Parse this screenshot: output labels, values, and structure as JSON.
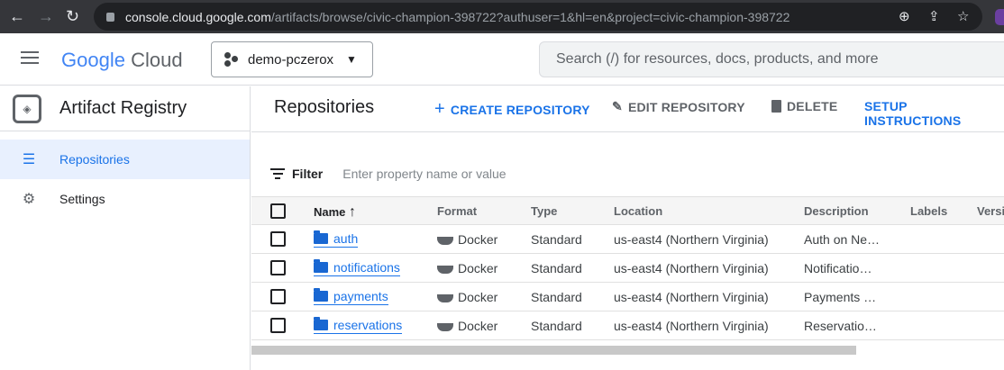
{
  "browser": {
    "url_host": "console.cloud.google.com",
    "url_path": "/artifacts/browse/civic-champion-398722?authuser=1&hl=en&project=civic-champion-398722"
  },
  "header": {
    "logo_google": "Google",
    "logo_cloud": "Cloud",
    "project": "demo-pczerox",
    "search_placeholder": "Search (/) for resources, docs, products, and more"
  },
  "sidebar": {
    "product": "Artifact Registry",
    "items": [
      {
        "label": "Repositories",
        "icon": "list-icon",
        "active": true
      },
      {
        "label": "Settings",
        "icon": "gear-icon"
      }
    ]
  },
  "toolbar": {
    "title": "Repositories",
    "create": "CREATE REPOSITORY",
    "edit": "EDIT REPOSITORY",
    "delete": "DELETE",
    "setup": "SETUP INSTRUCTIONS"
  },
  "filter": {
    "label": "Filter",
    "placeholder": "Enter property name or value"
  },
  "table": {
    "columns": [
      "Name",
      "Format",
      "Type",
      "Location",
      "Description",
      "Labels",
      "Versi"
    ],
    "sort": "Name ascending",
    "rows": [
      {
        "name": "auth",
        "format": "Docker",
        "type": "Standard",
        "location": "us-east4 (Northern Virginia)",
        "description": "Auth on Ne…"
      },
      {
        "name": "notifications",
        "format": "Docker",
        "type": "Standard",
        "location": "us-east4 (Northern Virginia)",
        "description": "Notificatio…"
      },
      {
        "name": "payments",
        "format": "Docker",
        "type": "Standard",
        "location": "us-east4 (Northern Virginia)",
        "description": "Payments …"
      },
      {
        "name": "reservations",
        "format": "Docker",
        "type": "Standard",
        "location": "us-east4 (Northern Virginia)",
        "description": "Reservatio…"
      }
    ]
  },
  "colors": {
    "accent": "#1a73e8",
    "active_bg": "#e8f0fe"
  }
}
